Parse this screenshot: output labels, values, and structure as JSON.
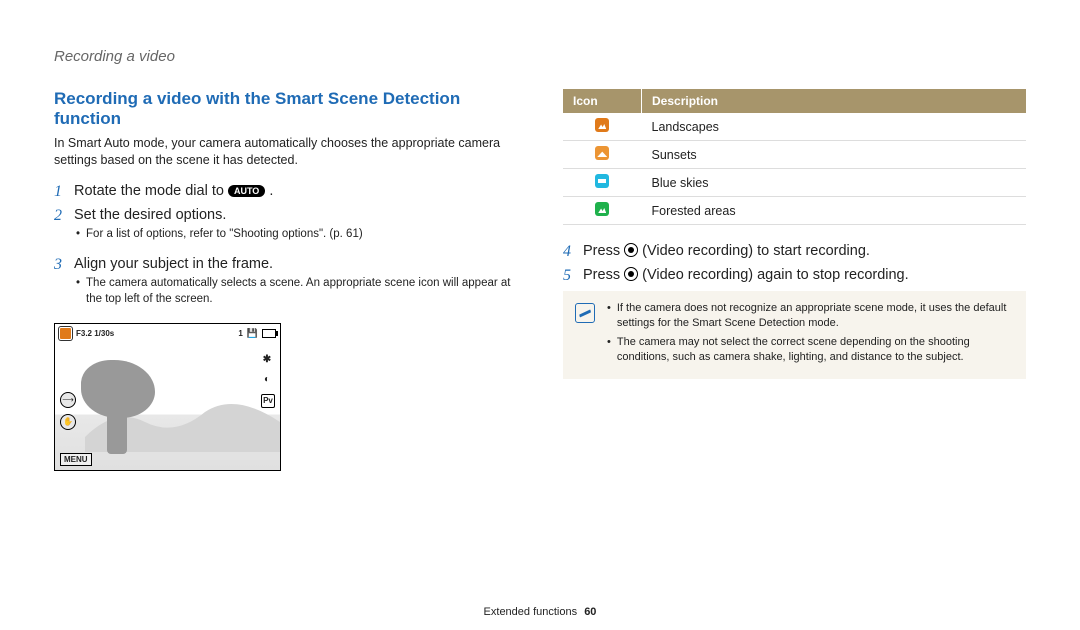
{
  "header": "Recording a video",
  "title": "Recording a video with the Smart Scene Detection function",
  "intro": "In Smart Auto mode, your camera automatically chooses the appropriate camera settings based on the scene it has detected.",
  "auto_label": "AUTO",
  "display": {
    "f_text": "F3.2 1/30s",
    "card": "1",
    "menu": "MENU"
  },
  "steps_left": [
    {
      "num": "1",
      "text_pre": "Rotate the mode dial to ",
      "text_post": " .",
      "has_auto": true,
      "subs": []
    },
    {
      "num": "2",
      "text_pre": "Set the desired options.",
      "text_post": "",
      "has_auto": false,
      "subs": [
        "For a list of options, refer to \"Shooting options\". (p. 61)"
      ]
    },
    {
      "num": "3",
      "text_pre": "Align your subject in the frame.",
      "text_post": "",
      "has_auto": false,
      "subs": [
        "The camera automatically selects a scene. An appropriate scene icon will appear at the top left of the screen."
      ]
    }
  ],
  "table": {
    "head_icon": "Icon",
    "head_desc": "Description",
    "rows": [
      {
        "cls": "mi-orange",
        "desc": "Landscapes"
      },
      {
        "cls": "mi-orange2",
        "desc": "Sunsets"
      },
      {
        "cls": "mi-blue",
        "desc": "Blue skies"
      },
      {
        "cls": "mi-green",
        "desc": "Forested areas"
      }
    ]
  },
  "steps_right": [
    {
      "num": "4",
      "pre": "Press ",
      "mid": " (Video recording) to start recording."
    },
    {
      "num": "5",
      "pre": "Press ",
      "mid": " (Video recording) again to stop recording."
    }
  ],
  "notes": [
    "If the camera does not recognize an appropriate scene mode, it uses the default settings for the Smart Scene Detection mode.",
    "The camera may not select the correct scene depending on the shooting conditions, such as camera shake, lighting, and distance to the subject."
  ],
  "footer_section": "Extended functions",
  "footer_page": "60"
}
